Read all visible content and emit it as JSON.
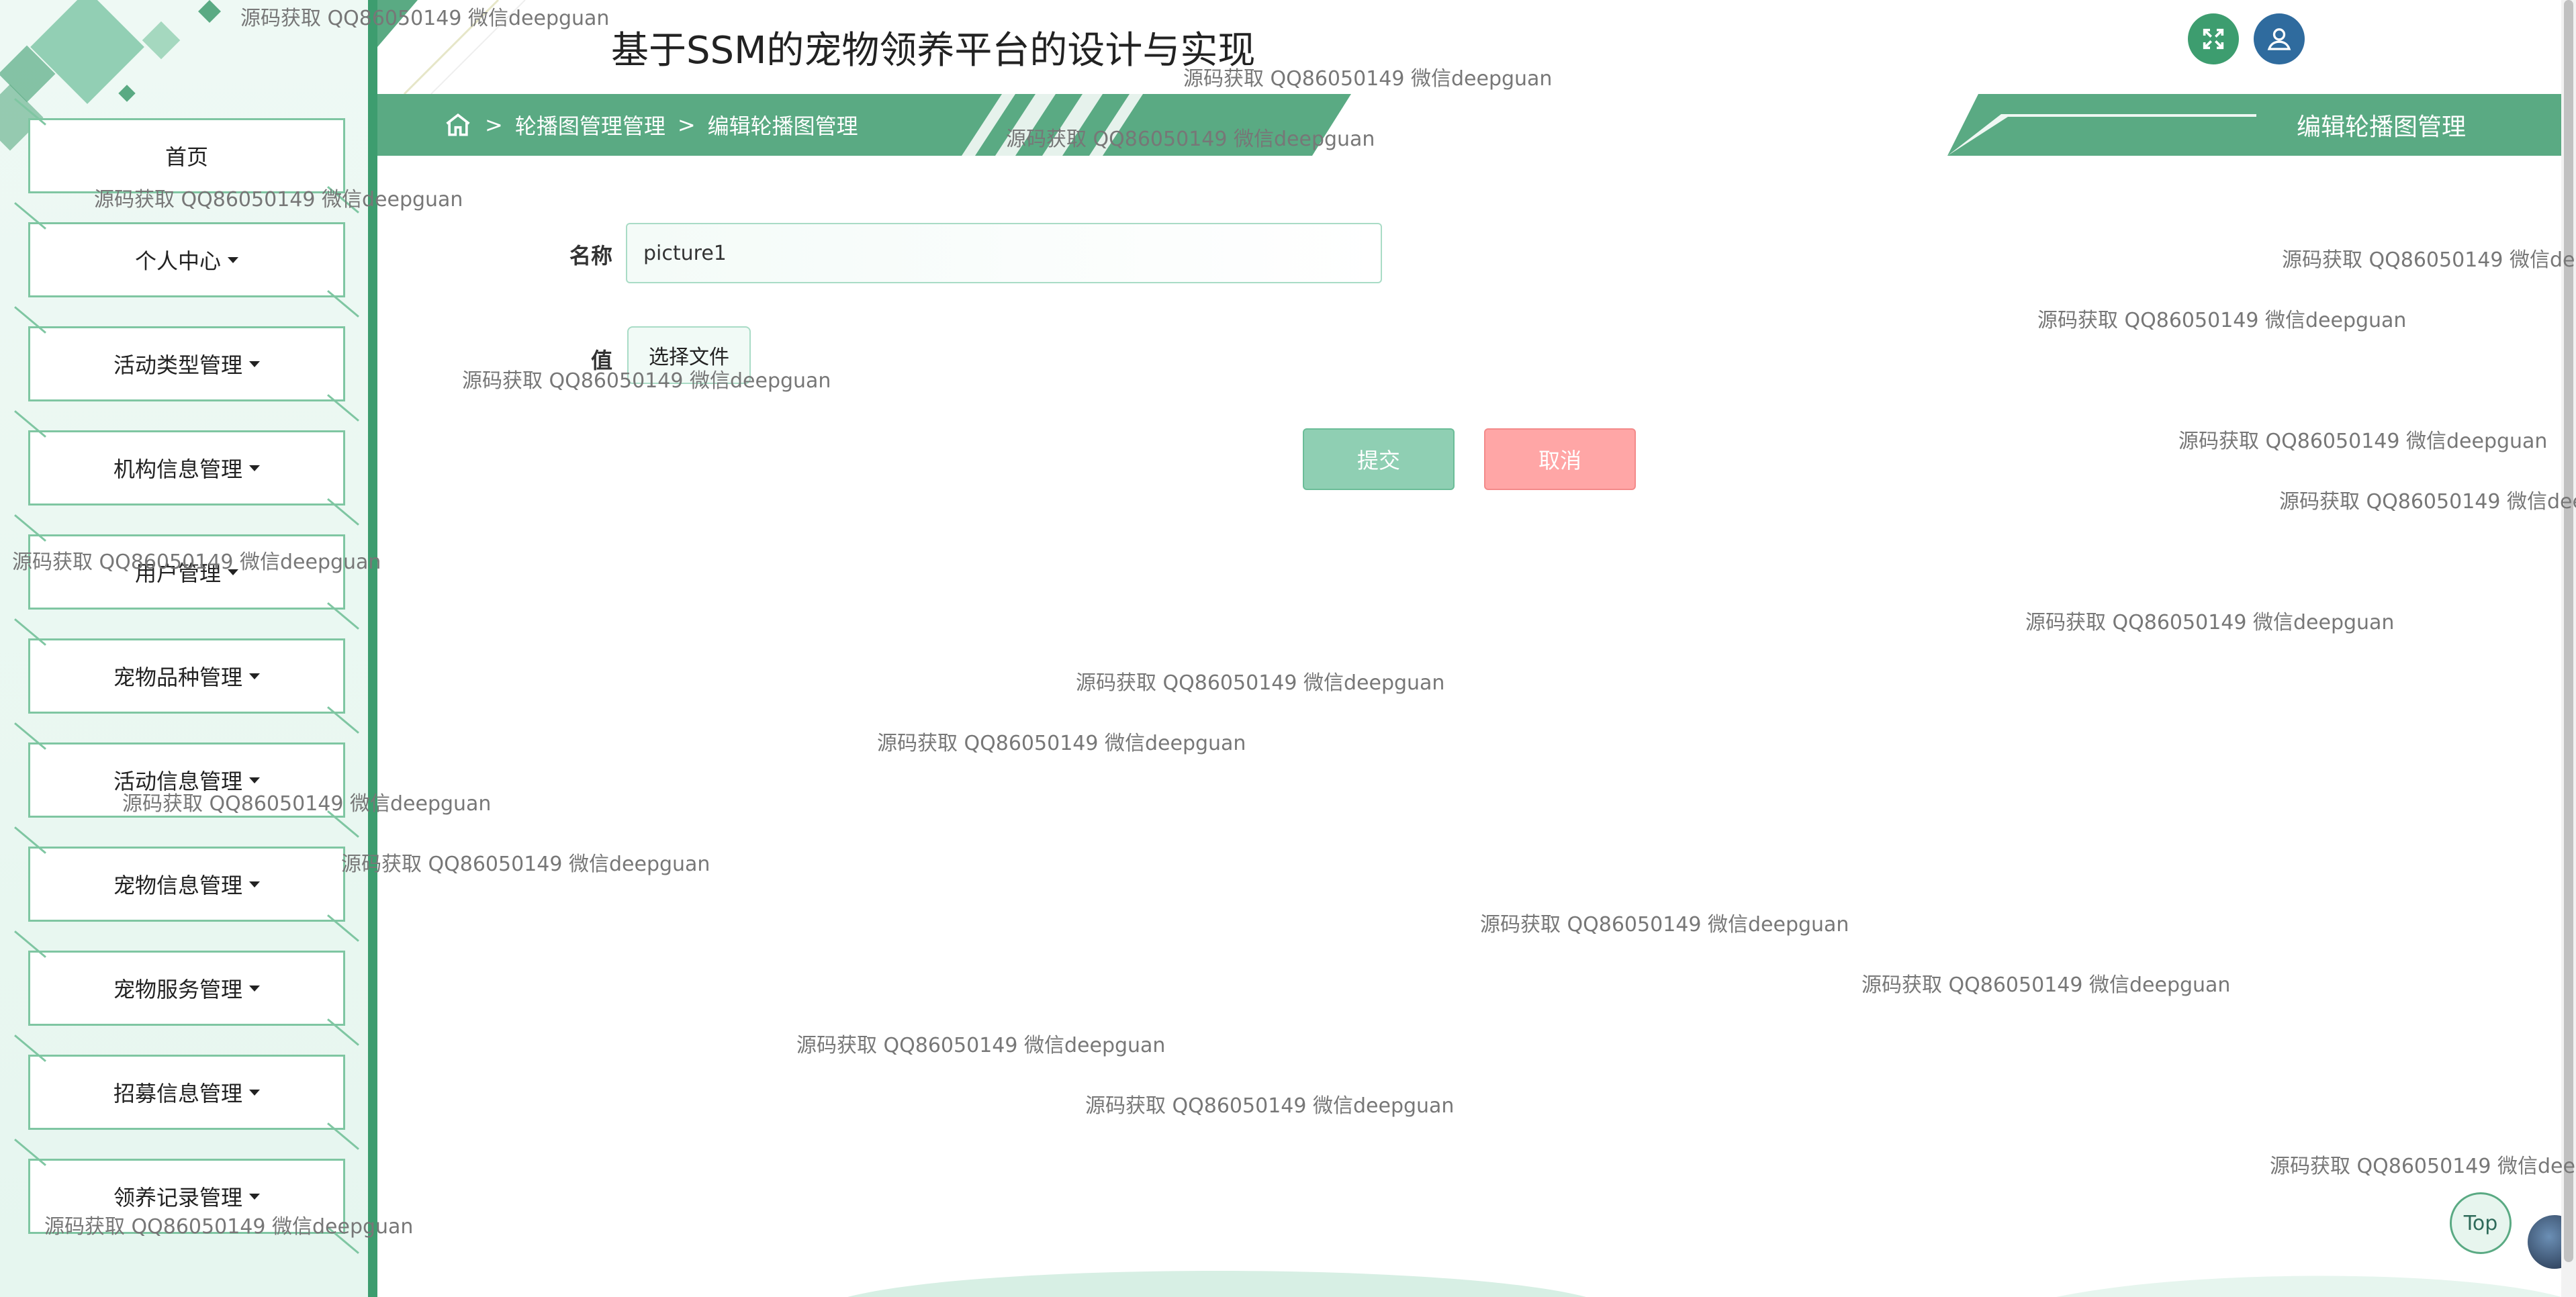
{
  "header": {
    "app_title": "基于SSM的宠物领养平台的设计与实现"
  },
  "breadcrumb": {
    "items": [
      "轮播图管理管理",
      "编辑轮播图管理"
    ],
    "separator": ">"
  },
  "page_title": "编辑轮播图管理",
  "sidebar": {
    "items": [
      {
        "label": "首页",
        "dropdown": false
      },
      {
        "label": "个人中心",
        "dropdown": true
      },
      {
        "label": "活动类型管理",
        "dropdown": true
      },
      {
        "label": "机构信息管理",
        "dropdown": true
      },
      {
        "label": "用户管理",
        "dropdown": true
      },
      {
        "label": "宠物品种管理",
        "dropdown": true
      },
      {
        "label": "活动信息管理",
        "dropdown": true
      },
      {
        "label": "宠物信息管理",
        "dropdown": true
      },
      {
        "label": "宠物服务管理",
        "dropdown": true
      },
      {
        "label": "招募信息管理",
        "dropdown": true
      },
      {
        "label": "领养记录管理",
        "dropdown": true
      }
    ]
  },
  "form": {
    "name_label": "名称",
    "name_value": "picture1",
    "value_label": "值",
    "file_button": "选择文件",
    "submit": "提交",
    "cancel": "取消"
  },
  "top_button": "Top",
  "watermark_text": "源码获取 QQ86050149 微信deepguan",
  "colors": {
    "primary": "#5aaa83",
    "sidebar_bg": "#eef9f4",
    "submit": "#8fcfb3",
    "cancel": "#ffa6a6",
    "user_icon": "#2f6b9e"
  }
}
